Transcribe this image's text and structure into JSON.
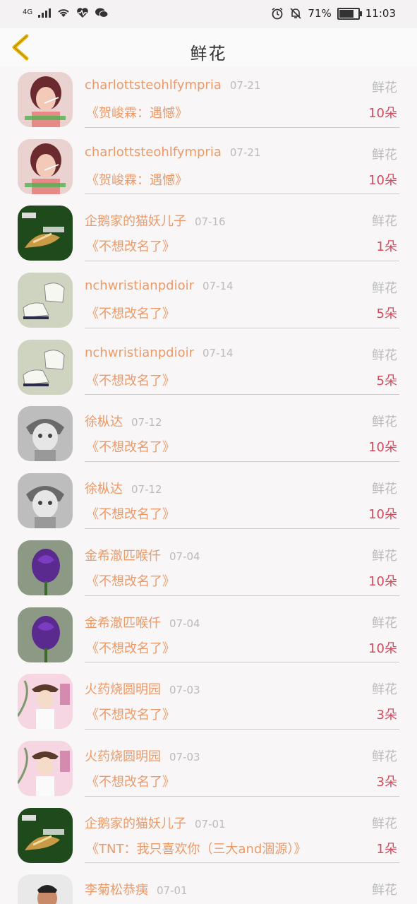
{
  "status": {
    "network": "4G",
    "battery_percent": "71%",
    "battery_level": 0.71,
    "time": "11:03"
  },
  "header": {
    "title": "鲜花"
  },
  "rows": [
    {
      "name": "charlottsteohlfympria",
      "date": "07-21",
      "type": "鲜花",
      "book": "《贺峻霖：遇憾》",
      "count": "10朵",
      "avatar": "woman-smoking"
    },
    {
      "name": "charlottsteohlfympria",
      "date": "07-21",
      "type": "鲜花",
      "book": "《贺峻霖：遇憾》",
      "count": "10朵",
      "avatar": "woman-smoking"
    },
    {
      "name": "企鹅家的猫妖儿子",
      "date": "07-16",
      "type": "鲜花",
      "book": "《不想改名了》",
      "count": "1朵",
      "avatar": "penguin-logo"
    },
    {
      "name": "nchwristianpdioir",
      "date": "07-14",
      "type": "鲜花",
      "book": "《不想改名了》",
      "count": "5朵",
      "avatar": "sneakers"
    },
    {
      "name": "nchwristianpdioir",
      "date": "07-14",
      "type": "鲜花",
      "book": "《不想改名了》",
      "count": "5朵",
      "avatar": "sneakers"
    },
    {
      "name": "徐枞达",
      "date": "07-12",
      "type": "鲜花",
      "book": "《不想改名了》",
      "count": "10朵",
      "avatar": "anime-sketch"
    },
    {
      "name": "徐枞达",
      "date": "07-12",
      "type": "鲜花",
      "book": "《不想改名了》",
      "count": "10朵",
      "avatar": "anime-sketch"
    },
    {
      "name": "金希澈匹喉仟",
      "date": "07-04",
      "type": "鲜花",
      "book": "《不想改名了》",
      "count": "10朵",
      "avatar": "purple-rose"
    },
    {
      "name": "金希澈匹喉仟",
      "date": "07-04",
      "type": "鲜花",
      "book": "《不想改名了》",
      "count": "10朵",
      "avatar": "purple-rose"
    },
    {
      "name": "火药烧圆明园",
      "date": "07-03",
      "type": "鲜花",
      "book": "《不想改名了》",
      "count": "3朵",
      "avatar": "anime-boy-pink"
    },
    {
      "name": "火药烧圆明园",
      "date": "07-03",
      "type": "鲜花",
      "book": "《不想改名了》",
      "count": "3朵",
      "avatar": "anime-boy-pink"
    },
    {
      "name": "企鹅家的猫妖儿子",
      "date": "07-01",
      "type": "鲜花",
      "book": "《TNT：我只喜欢你（三大and涸源）》",
      "count": "1朵",
      "avatar": "penguin-logo"
    },
    {
      "name": "李菊松恭痍",
      "date": "07-01",
      "type": "鲜花",
      "book": "",
      "count": "",
      "avatar": "man-photo"
    }
  ],
  "colors": {
    "accent_orange": "#ed9a68",
    "count_red": "#d24b5f",
    "muted_gray": "#bbbbbb",
    "back_arrow": "#e9b400"
  }
}
